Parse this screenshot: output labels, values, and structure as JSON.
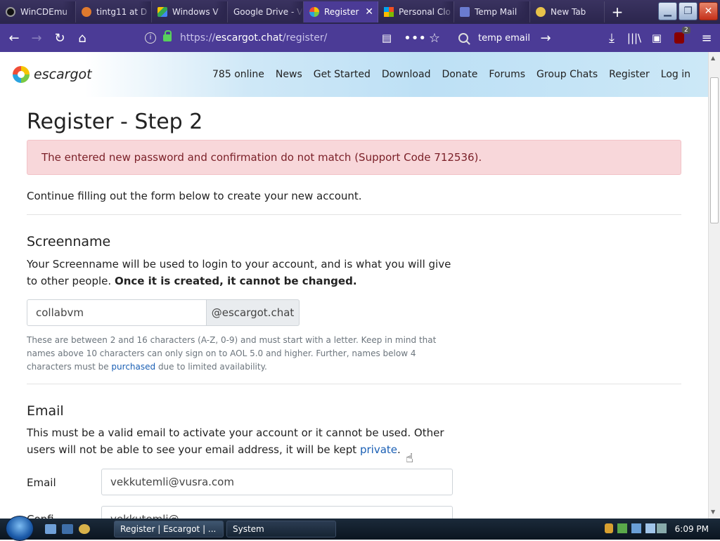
{
  "browser": {
    "tabs": [
      {
        "label": "WinCDEmu",
        "color": "#222222",
        "active": false
      },
      {
        "label": "tintg11 at D",
        "color": "#e07a2e",
        "active": false
      },
      {
        "label": "Windows V",
        "color": "#3a8fd9",
        "active": false
      },
      {
        "label": "Google Drive - V",
        "color": "#2b254d",
        "active": false
      },
      {
        "label": "Register",
        "color": "#7ac943",
        "active": true
      },
      {
        "label": "Personal Clo",
        "color": "#f04e37",
        "active": false
      },
      {
        "label": "Temp Mail",
        "color": "#6a7bd0",
        "active": false
      },
      {
        "label": "New Tab",
        "color": "#e8c24a",
        "active": false
      }
    ],
    "new_tab_symbol": "+",
    "url_prefix": "https://",
    "url_host": "escargot.chat",
    "url_path": "/register/",
    "search_text": "temp email",
    "addon_badge": "2"
  },
  "site": {
    "logo_text": "escargot",
    "nav": [
      "785 online",
      "News",
      "Get Started",
      "Download",
      "Donate",
      "Forums",
      "Group Chats",
      "Register",
      "Log in"
    ]
  },
  "page": {
    "title": "Register - Step 2",
    "alert": "The entered new password and confirmation do not match (Support Code 712536).",
    "intro": "Continue filling out the form below to create your new account.",
    "screenname": {
      "heading": "Screenname",
      "desc_part1": "Your Screenname will be used to login to your account, and is what you will give to other people. ",
      "desc_bold": "Once it is created, it cannot be changed.",
      "value": "collabvm",
      "suffix": "@escargot.chat",
      "help_part1": "These are between 2 and 16 characters (A-Z, 0-9) and must start with a letter. Keep in mind that names above 10 characters can only sign on to AOL 5.0 and higher. Further, names below 4 characters must be ",
      "help_link": "purchased",
      "help_part2": " due to limited availability."
    },
    "email": {
      "heading": "Email",
      "desc_part1": "This must be a valid email to activate your account or it cannot be used. Other users will not be able to see your email address, it will be kept ",
      "desc_link": "private",
      "desc_part2": ".",
      "label": "Email",
      "value": "vekkutemli@vusra.com",
      "confirm_label": "Confi",
      "confirm_value": "vekkutemli@"
    }
  },
  "taskbar": {
    "buttons": [
      "Register | Escargot | ...",
      "System"
    ],
    "clock": "6:09 PM"
  },
  "colors": {
    "browser_dark": "#2b254d",
    "browser_accent": "#4b3b96",
    "alert_bg": "#f8d7da",
    "link": "#1a5fb4"
  }
}
